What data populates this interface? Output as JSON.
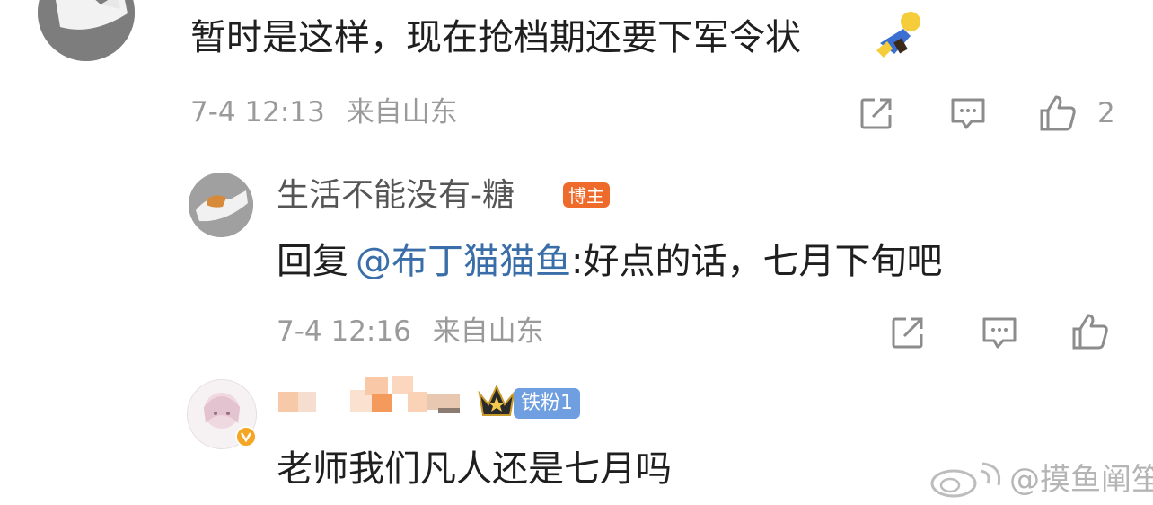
{
  "comments": [
    {
      "text": "暂时是这样，现在抢档期还要下军令状",
      "time": "7-4 12:13",
      "location": "来自山东",
      "like_count": "2"
    },
    {
      "username": "生活不能没有-糖",
      "badge": "博主",
      "reply_prefix": "回复",
      "mention": "@布丁猫猫鱼",
      "reply_text": ":好点的话，七月下旬吧",
      "time": "7-4 12:16",
      "location": "来自山东"
    },
    {
      "badge": "铁粉1",
      "text": "老师我们凡人还是七月吗"
    }
  ],
  "watermark": "@摸鱼阐笙",
  "colors": {
    "mention": "#3a6ea8",
    "blogger_badge": "#ef6b2c",
    "fan_badge": "#6f9fe0",
    "verified": "#f5a623"
  }
}
